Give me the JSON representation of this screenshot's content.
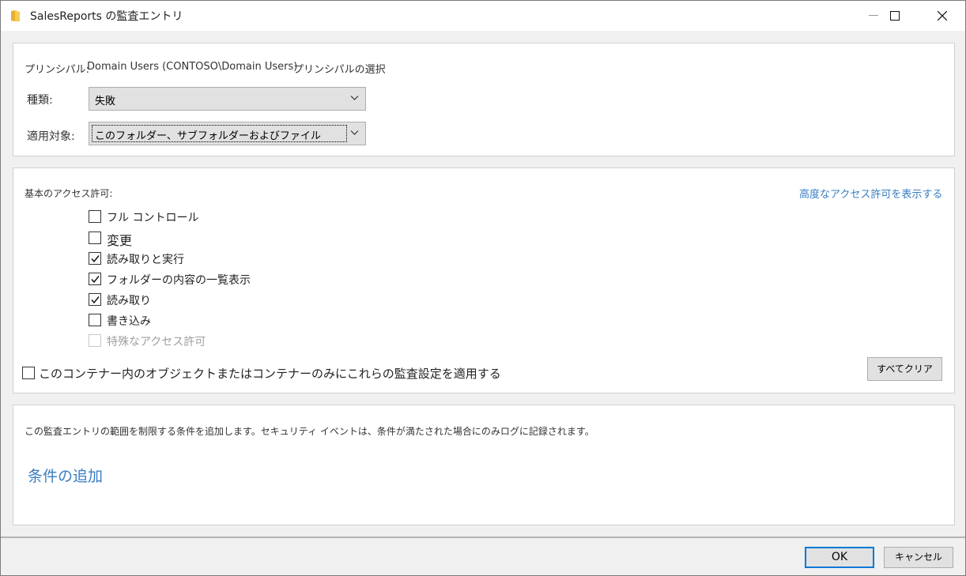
{
  "window": {
    "title": "SalesReports の監査エントリ",
    "icon": "folder-icon"
  },
  "principal": {
    "label": "プリンシパル:",
    "value": "Domain Users (CONTOSO\\Domain Users)",
    "select_link": "プリンシパルの選択"
  },
  "type": {
    "label": "種類:",
    "value": "失敗"
  },
  "applies_to": {
    "label": "適用対象:",
    "value": "このフォルダー、サブフォルダーおよびファイル"
  },
  "permissions": {
    "heading": "基本のアクセス許可:",
    "advanced_link": "高度なアクセス許可を表示する",
    "items": [
      {
        "label": "フル コントロール",
        "checked": false,
        "enabled": true
      },
      {
        "label": "変更",
        "checked": false,
        "enabled": true
      },
      {
        "label": "読み取りと実行",
        "checked": true,
        "enabled": true
      },
      {
        "label": "フォルダーの内容の一覧表示",
        "checked": true,
        "enabled": true
      },
      {
        "label": "読み取り",
        "checked": true,
        "enabled": true
      },
      {
        "label": "書き込み",
        "checked": false,
        "enabled": true
      },
      {
        "label": "特殊なアクセス許可",
        "checked": false,
        "enabled": false
      }
    ],
    "apply_container_only": {
      "label": "このコンテナー内のオブジェクトまたはコンテナーのみにこれらの監査設定を適用する",
      "checked": false
    },
    "clear_all": "すべてクリア"
  },
  "conditions": {
    "description": "この監査エントリの範囲を制限する条件を追加します。セキュリティ イベントは、条件が満たされた場合にのみログに記録されます。",
    "add_link": "条件の追加"
  },
  "footer": {
    "ok": "OK",
    "cancel": "キャンセル"
  }
}
